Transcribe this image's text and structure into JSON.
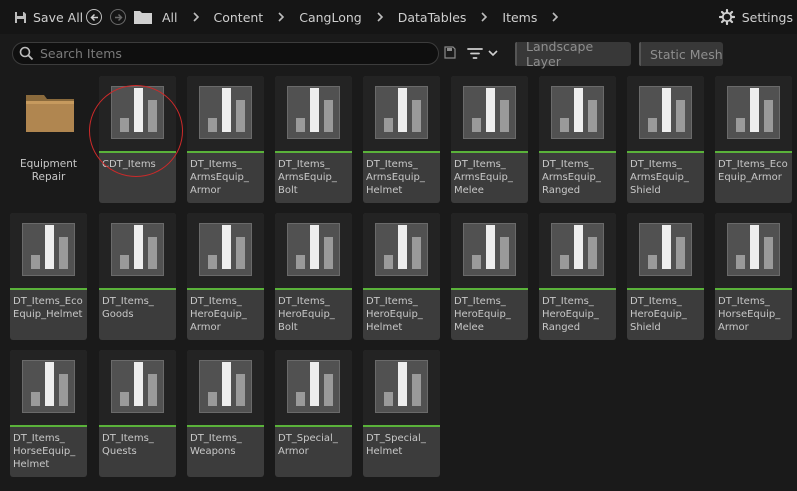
{
  "toolbar": {
    "save_all_label": "Save All",
    "breadcrumbs": [
      "All",
      "Content",
      "CangLong",
      "DataTables",
      "Items"
    ],
    "settings_label": "Settings"
  },
  "filters": {
    "search_placeholder": "Search Items",
    "search_value": "",
    "chips": [
      "Landscape Layer",
      "Static Mesh"
    ]
  },
  "folder": {
    "label": "Equipment\nRepair",
    "icon": "folder-icon"
  },
  "assets": [
    "CDT_Items",
    "DT_Items_\nArmsEquip_\nArmor",
    "DT_Items_\nArmsEquip_\nBolt",
    "DT_Items_\nArmsEquip_\nHelmet",
    "DT_Items_\nArmsEquip_\nMelee",
    "DT_Items_\nArmsEquip_\nRanged",
    "DT_Items_\nArmsEquip_\nShield",
    "DT_Items_Eco\nEquip_Armor",
    "DT_Items_Eco\nEquip_Helmet",
    "DT_Items_\nGoods",
    "DT_Items_\nHeroEquip_\nArmor",
    "DT_Items_\nHeroEquip_\nBolt",
    "DT_Items_\nHeroEquip_\nHelmet",
    "DT_Items_\nHeroEquip_\nMelee",
    "DT_Items_\nHeroEquip_\nRanged",
    "DT_Items_\nHeroEquip_\nShield",
    "DT_Items_\nHorseEquip_\nArmor",
    "DT_Items_\nHorseEquip_\nHelmet",
    "DT_Items_\nQuests",
    "DT_Items_\nWeapons",
    "DT_Special_\nArmor",
    "DT_Special_\nHelmet"
  ],
  "colors": {
    "asset_type_bar": "#5ab23a",
    "highlight": "#cc2a2a",
    "folder": "#a07a45"
  }
}
